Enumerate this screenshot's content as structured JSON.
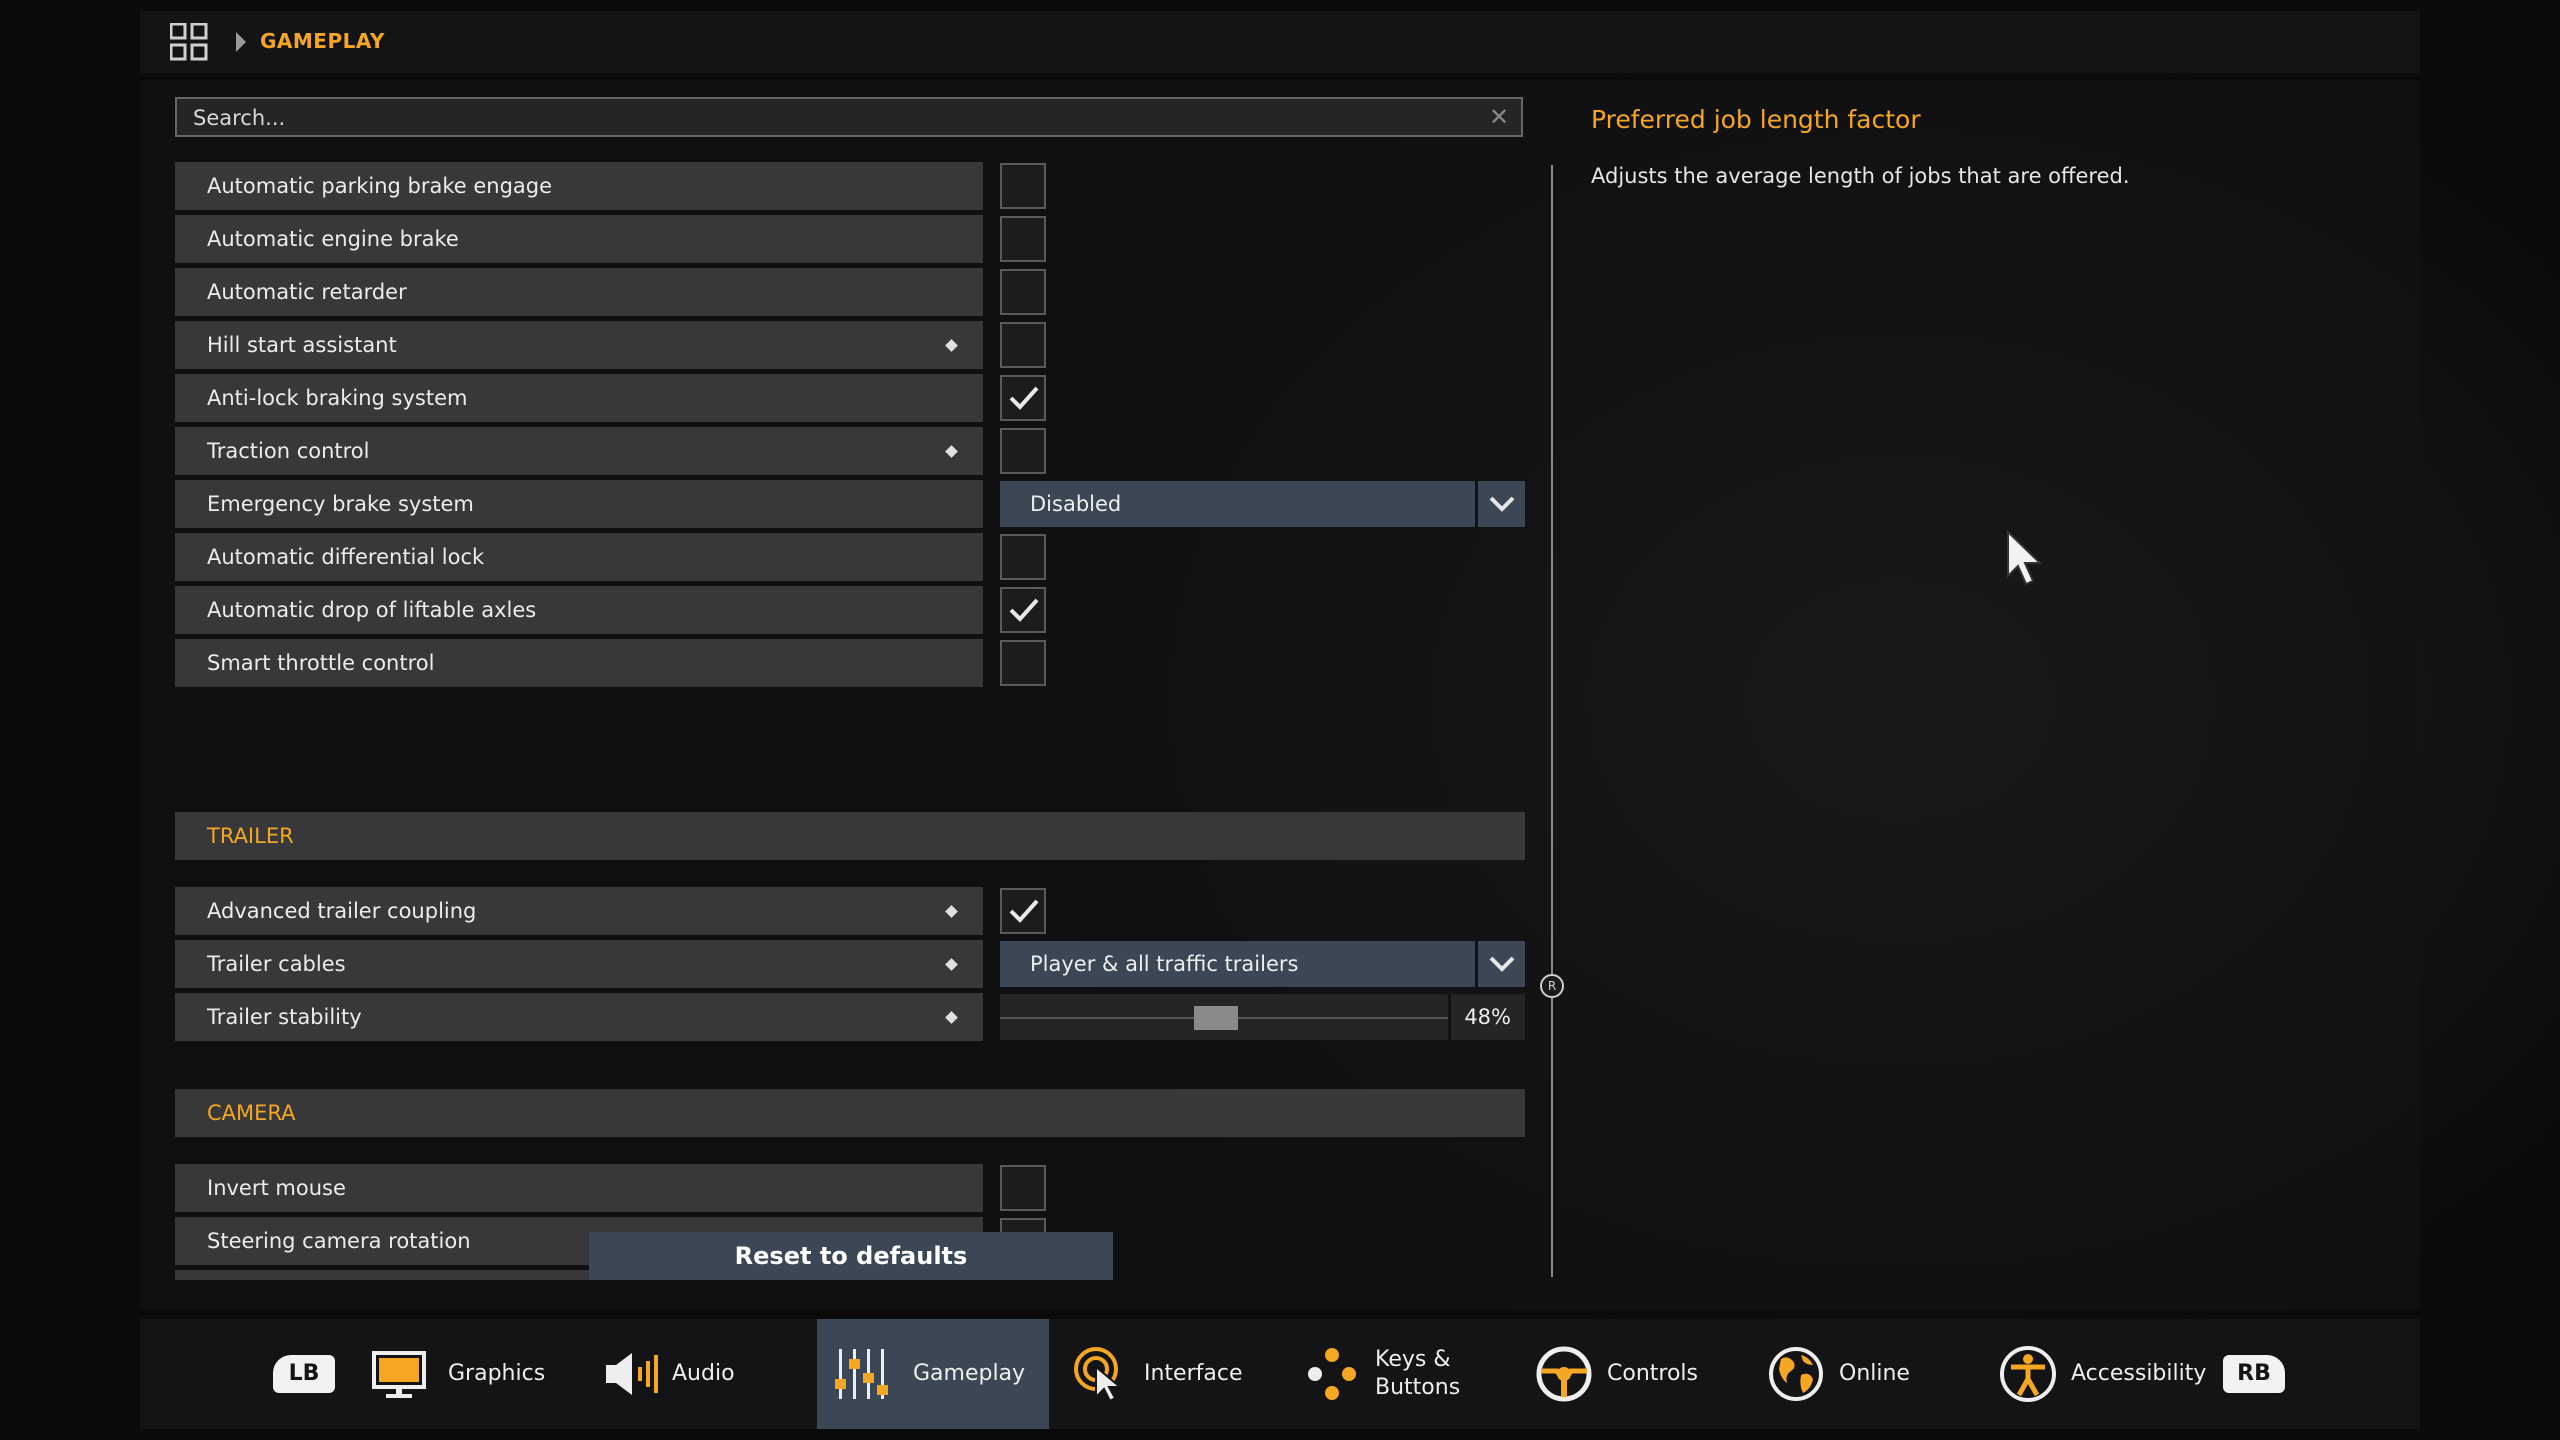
{
  "breadcrumb": {
    "current": "GAMEPLAY"
  },
  "search": {
    "placeholder": "Search..."
  },
  "rows_top": [
    {
      "label": "Automatic parking brake engage",
      "modified": false,
      "control": "checkbox",
      "checked": false
    },
    {
      "label": "Automatic engine brake",
      "modified": false,
      "control": "checkbox",
      "checked": false
    },
    {
      "label": "Automatic retarder",
      "modified": false,
      "control": "checkbox",
      "checked": false
    },
    {
      "label": "Hill start assistant",
      "modified": true,
      "control": "checkbox",
      "checked": false
    },
    {
      "label": "Anti-lock braking system",
      "modified": false,
      "control": "checkbox",
      "checked": true
    },
    {
      "label": "Traction control",
      "modified": true,
      "control": "checkbox",
      "checked": false
    },
    {
      "label": "Emergency brake system",
      "modified": false,
      "control": "dropdown",
      "value": "Disabled"
    },
    {
      "label": "Automatic differential lock",
      "modified": false,
      "control": "checkbox",
      "checked": false
    },
    {
      "label": "Automatic drop of liftable axles",
      "modified": false,
      "control": "checkbox",
      "checked": true
    },
    {
      "label": "Smart throttle control",
      "modified": false,
      "control": "checkbox",
      "checked": false
    }
  ],
  "sections": {
    "trailer": "TRAILER",
    "camera": "CAMERA"
  },
  "trailer_rows": {
    "coupling": {
      "label": "Advanced trailer coupling",
      "checked": true
    },
    "cables": {
      "label": "Trailer cables",
      "value": "Player & all traffic trailers"
    },
    "stability": {
      "label": "Trailer stability",
      "value_text": "48%",
      "value": 0.48
    }
  },
  "camera_rows": [
    {
      "label": "Invert mouse",
      "checked": false
    },
    {
      "label": "Steering camera rotation",
      "checked": false
    }
  ],
  "reset_label": "Reset to defaults",
  "info": {
    "title": "Preferred job length factor",
    "description": "Adjusts the average length of jobs that are offered."
  },
  "nav": {
    "lb": "LB",
    "rb": "RB",
    "graphics": "Graphics",
    "audio": "Audio",
    "gameplay": "Gameplay",
    "interface": "Interface",
    "keys_line1": "Keys &",
    "keys_line2": "Buttons",
    "controls": "Controls",
    "online": "Online",
    "accessibility": "Accessibility"
  },
  "colors": {
    "accent": "#f5a623",
    "control_blue": "#3b4754"
  }
}
